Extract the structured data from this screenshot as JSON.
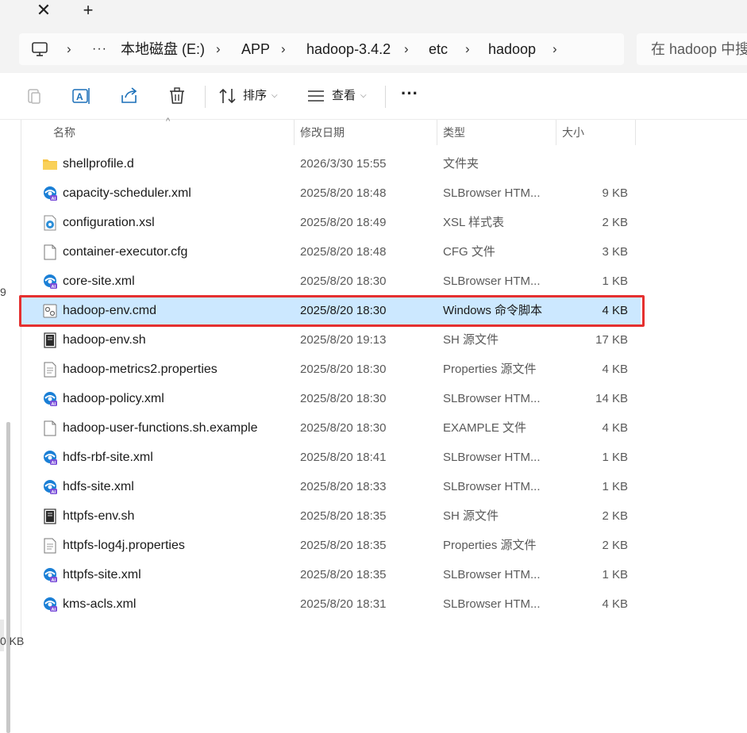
{
  "tabs": {
    "close_glyph": "✕",
    "new_glyph": "+"
  },
  "address": {
    "crumbs": [
      "本地磁盘 (E:)",
      "APP",
      "hadoop-3.4.2",
      "etc",
      "hadoop"
    ],
    "more_glyph": "···",
    "chevron_glyph": "›",
    "search_placeholder": "在 hadoop 中搜"
  },
  "toolbar": {
    "sort_label": "排序",
    "view_label": "查看",
    "more_glyph": "···",
    "icons": [
      "paste-icon",
      "rename-icon",
      "share-icon",
      "delete-icon",
      "sort-icon",
      "view-icon"
    ]
  },
  "columns": {
    "name": "名称",
    "modified": "修改日期",
    "type": "类型",
    "size": "大小"
  },
  "files": [
    {
      "name": "shellprofile.d",
      "date": "2026/3/30 15:55",
      "type": "文件夹",
      "size": "",
      "icon": "folder"
    },
    {
      "name": "capacity-scheduler.xml",
      "date": "2025/8/20 18:48",
      "type": "SLBrowser HTM...",
      "size": "9 KB",
      "icon": "browser"
    },
    {
      "name": "configuration.xsl",
      "date": "2025/8/20 18:49",
      "type": "XSL 样式表",
      "size": "2 KB",
      "icon": "xsl"
    },
    {
      "name": "container-executor.cfg",
      "date": "2025/8/20 18:48",
      "type": "CFG 文件",
      "size": "3 KB",
      "icon": "blank"
    },
    {
      "name": "core-site.xml",
      "date": "2025/8/20 18:30",
      "type": "SLBrowser HTM...",
      "size": "1 KB",
      "icon": "browser"
    },
    {
      "name": "hadoop-env.cmd",
      "date": "2025/8/20 18:30",
      "type": "Windows 命令脚本",
      "size": "4 KB",
      "icon": "cmd",
      "selected": true
    },
    {
      "name": "hadoop-env.sh",
      "date": "2025/8/20 19:13",
      "type": "SH 源文件",
      "size": "17 KB",
      "icon": "sh"
    },
    {
      "name": "hadoop-metrics2.properties",
      "date": "2025/8/20 18:30",
      "type": "Properties 源文件",
      "size": "4 KB",
      "icon": "text"
    },
    {
      "name": "hadoop-policy.xml",
      "date": "2025/8/20 18:30",
      "type": "SLBrowser HTM...",
      "size": "14 KB",
      "icon": "browser"
    },
    {
      "name": "hadoop-user-functions.sh.example",
      "date": "2025/8/20 18:30",
      "type": "EXAMPLE 文件",
      "size": "4 KB",
      "icon": "blank"
    },
    {
      "name": "hdfs-rbf-site.xml",
      "date": "2025/8/20 18:41",
      "type": "SLBrowser HTM...",
      "size": "1 KB",
      "icon": "browser"
    },
    {
      "name": "hdfs-site.xml",
      "date": "2025/8/20 18:33",
      "type": "SLBrowser HTM...",
      "size": "1 KB",
      "icon": "browser"
    },
    {
      "name": "httpfs-env.sh",
      "date": "2025/8/20 18:35",
      "type": "SH 源文件",
      "size": "2 KB",
      "icon": "sh"
    },
    {
      "name": "httpfs-log4j.properties",
      "date": "2025/8/20 18:35",
      "type": "Properties 源文件",
      "size": "2 KB",
      "icon": "text"
    },
    {
      "name": "httpfs-site.xml",
      "date": "2025/8/20 18:35",
      "type": "SLBrowser HTM...",
      "size": "1 KB",
      "icon": "browser"
    },
    {
      "name": "kms-acls.xml",
      "date": "2025/8/20 18:31",
      "type": "SLBrowser HTM...",
      "size": "4 KB",
      "icon": "browser"
    }
  ],
  "left_fragments": {
    "top": "9",
    "bottom": "0 KB"
  },
  "colors": {
    "selection": "#cce8ff",
    "highlight_outline": "#e5302f",
    "folder": "#f7c342",
    "browser_blue": "#1a7fd6"
  }
}
